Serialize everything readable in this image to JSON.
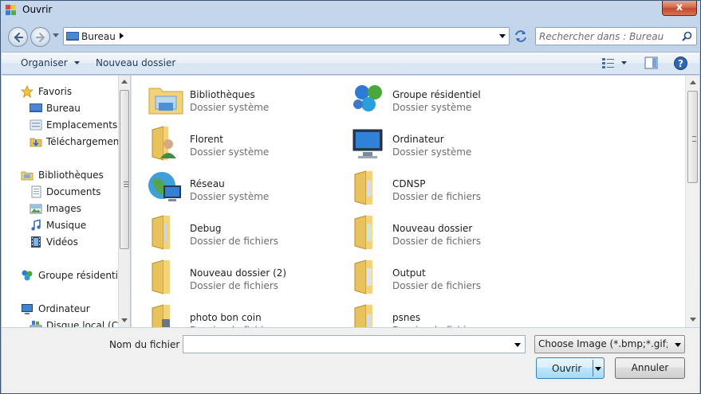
{
  "window": {
    "title": "Ouvrir",
    "close_glyph": "x"
  },
  "address": {
    "crumbs": [
      "Bureau"
    ],
    "search_placeholder": "Rechercher dans : Bureau"
  },
  "toolbar": {
    "organise_label": "Organiser",
    "new_folder_label": "Nouveau dossier"
  },
  "navpane": {
    "items": [
      {
        "label": "Favoris",
        "icon": "star-icon"
      },
      {
        "label": "Bureau",
        "icon": "desktop-icon"
      },
      {
        "label": "Emplacements ré",
        "icon": "recent-places-icon"
      },
      {
        "label": "Téléchargements",
        "icon": "downloads-icon"
      },
      {
        "label": "Bibliothèques",
        "icon": "libraries-icon"
      },
      {
        "label": "Documents",
        "icon": "documents-icon"
      },
      {
        "label": "Images",
        "icon": "pictures-icon"
      },
      {
        "label": "Musique",
        "icon": "music-icon"
      },
      {
        "label": "Vidéos",
        "icon": "videos-icon"
      },
      {
        "label": "Groupe résidentiel",
        "icon": "homegroup-icon"
      },
      {
        "label": "Ordinateur",
        "icon": "computer-icon"
      },
      {
        "label": "Disque local (C:)",
        "icon": "drive-icon"
      }
    ]
  },
  "files": [
    {
      "name": "Bibliothèques",
      "type": "Dossier système",
      "icon": "libraries-icon"
    },
    {
      "name": "Groupe résidentiel",
      "type": "Dossier système",
      "icon": "homegroup-icon"
    },
    {
      "name": "Florent",
      "type": "Dossier système",
      "icon": "user-folder-icon"
    },
    {
      "name": "Ordinateur",
      "type": "Dossier système",
      "icon": "computer-icon"
    },
    {
      "name": "Réseau",
      "type": "Dossier système",
      "icon": "network-icon"
    },
    {
      "name": "CDNSP",
      "type": "Dossier de fichiers",
      "icon": "folder-icon"
    },
    {
      "name": "Debug",
      "type": "Dossier de fichiers",
      "icon": "folder-icon"
    },
    {
      "name": "Nouveau dossier",
      "type": "Dossier de fichiers",
      "icon": "folder-icon"
    },
    {
      "name": "Nouveau dossier (2)",
      "type": "Dossier de fichiers",
      "icon": "folder-icon"
    },
    {
      "name": "Output",
      "type": "Dossier de fichiers",
      "icon": "folder-icon"
    },
    {
      "name": "photo bon coin",
      "type": "Dossier de fichiers",
      "icon": "folder-icon"
    },
    {
      "name": "psnes",
      "type": "Dossier de fichiers",
      "icon": "folder-icon"
    }
  ],
  "bottom": {
    "filename_label": "Nom du fichier :",
    "filename_value": "",
    "filter_value": "Choose Image (*.bmp;*.gif;*.jpg",
    "open_label": "Ouvrir",
    "cancel_label": "Annuler"
  },
  "colors": {
    "accent": "#3c7fb1",
    "close": "#c44a2b",
    "folder": "#f3d27a"
  }
}
